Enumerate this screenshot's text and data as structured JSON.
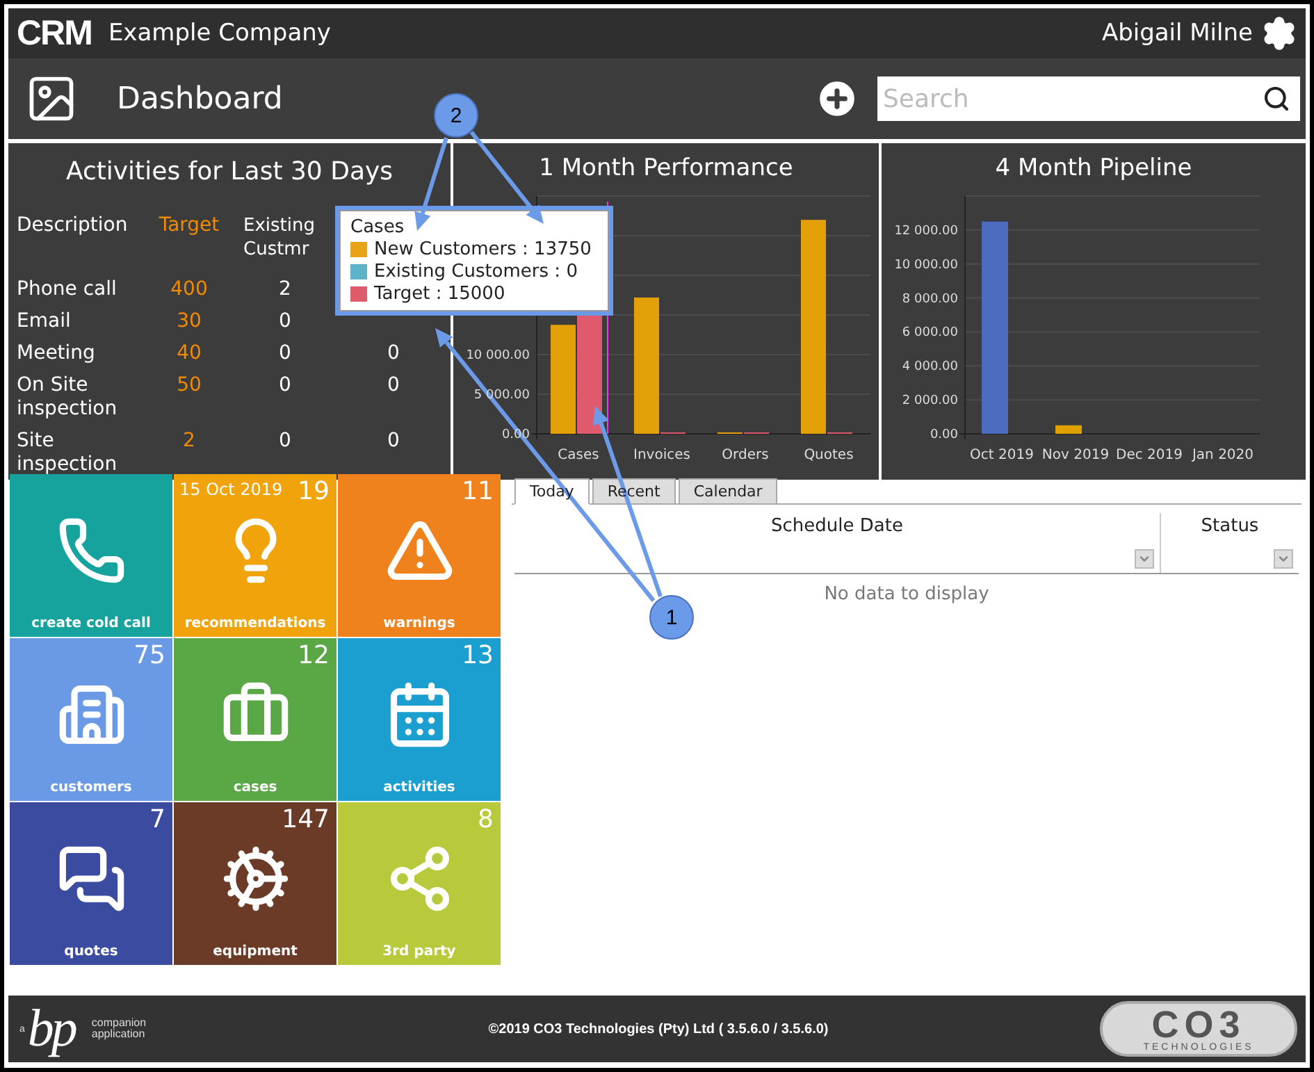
{
  "header": {
    "logo": "CRM",
    "company": "Example Company",
    "user": "Abigail Milne"
  },
  "nav": {
    "title": "Dashboard",
    "search": {
      "placeholder": "Search"
    }
  },
  "activities": {
    "title": "Activities for Last 30 Days",
    "columns": [
      "Description",
      "Target",
      "Existing Custmr"
    ],
    "rows": [
      {
        "cells": [
          "Phone call",
          "400",
          "2"
        ]
      },
      {
        "cells": [
          "Email",
          "30",
          "0"
        ]
      },
      {
        "cells": [
          "Meeting",
          "40",
          "0",
          "0"
        ]
      },
      {
        "cells": [
          "On Site inspection",
          "50",
          "0",
          "0"
        ]
      },
      {
        "cells": [
          "Site inspection",
          "2",
          "0",
          "0"
        ]
      }
    ]
  },
  "performance": {
    "chart_data": {
      "type": "bar",
      "title": "1 Month Performance",
      "categories": [
        "Cases",
        "Invoices",
        "Orders",
        "Quotes"
      ],
      "series": [
        {
          "color": "#e3a008",
          "values": [
            13750,
            17200,
            0,
            27000
          ]
        },
        {
          "color": "#5fb3c8",
          "values": [
            0,
            0,
            0,
            0
          ]
        },
        {
          "color": "#e05a6e",
          "values": [
            15000,
            0,
            0,
            0
          ]
        }
      ],
      "grid": true,
      "ylim": [
        0,
        30000
      ],
      "yticks": [
        {
          "value": 0,
          "label": "0.00"
        },
        {
          "value": 5000,
          "label": "5 000.00"
        },
        {
          "value": 10000,
          "label": "10 000.00"
        }
      ]
    }
  },
  "pipeline": {
    "chart_data": {
      "type": "bar",
      "title": "4 Month Pipeline",
      "categories": [
        "Oct 2019",
        "Nov 2019",
        "Dec 2019",
        "Jan 2020"
      ],
      "series": [
        {
          "color": "#4d6cc0",
          "values": [
            12500,
            null,
            null,
            null
          ]
        },
        {
          "color": "#e0a000",
          "values": [
            null,
            500,
            null,
            null
          ]
        }
      ],
      "grid": true,
      "ylim": [
        0,
        14000
      ],
      "yticks": [
        {
          "value": 0,
          "label": "0.00"
        },
        {
          "value": 2000,
          "label": "2 000.00"
        },
        {
          "value": 4000,
          "label": "4 000.00"
        },
        {
          "value": 6000,
          "label": "6 000.00"
        },
        {
          "value": 8000,
          "label": "8 000.00"
        },
        {
          "value": 10000,
          "label": "10 000.00"
        },
        {
          "value": 12000,
          "label": "12 000.00"
        }
      ]
    }
  },
  "tooltip": {
    "title": "Cases",
    "items": [
      {
        "text": "New Customers : 13750",
        "color": "#e8a317"
      },
      {
        "text": "Existing Customers : 0",
        "color": "#5fb3c8"
      },
      {
        "text": "Target : 15000",
        "color": "#e05a6e"
      }
    ]
  },
  "tiles": [
    {
      "label": "create cold call",
      "color": "#16a39e"
    },
    {
      "label": "recommendations",
      "count": "19",
      "date": "15 Oct 2019",
      "color": "#f0a30a"
    },
    {
      "label": "warnings",
      "count": "11",
      "color": "#f0821e"
    },
    {
      "label": "customers",
      "count": "75",
      "color": "#6a9ae6"
    },
    {
      "label": "cases",
      "count": "12",
      "color": "#5aa746"
    },
    {
      "label": "activities",
      "count": "13",
      "color": "#1a9fd0"
    },
    {
      "label": "quotes",
      "count": "7",
      "color": "#3b4ca0"
    },
    {
      "label": "equipment",
      "count": "147",
      "color": "#6b3b27"
    },
    {
      "label": "3rd party",
      "count": "8",
      "color": "#b8c93b"
    }
  ],
  "schedule": {
    "tabs": [
      {
        "label": "Today",
        "selected": true
      },
      {
        "label": "Recent",
        "selected": false
      },
      {
        "label": "Calendar",
        "selected": false
      }
    ],
    "columns": [
      "Schedule Date",
      "Status"
    ],
    "empty": "No data to display"
  },
  "footer": {
    "companion_logo": {
      "prefix": "a",
      "letters": "bp",
      "lines": [
        "companion",
        "application"
      ]
    },
    "copyright": "©2019 CO3 Technologies (Pty) Ltd ( 3.5.6.0 / 3.5.6.0)",
    "brand_logo": {
      "mark": "CO3",
      "subtitle": "TECHNOLOGIES"
    }
  },
  "callouts": [
    {
      "label": "2"
    },
    {
      "label": "1"
    }
  ]
}
